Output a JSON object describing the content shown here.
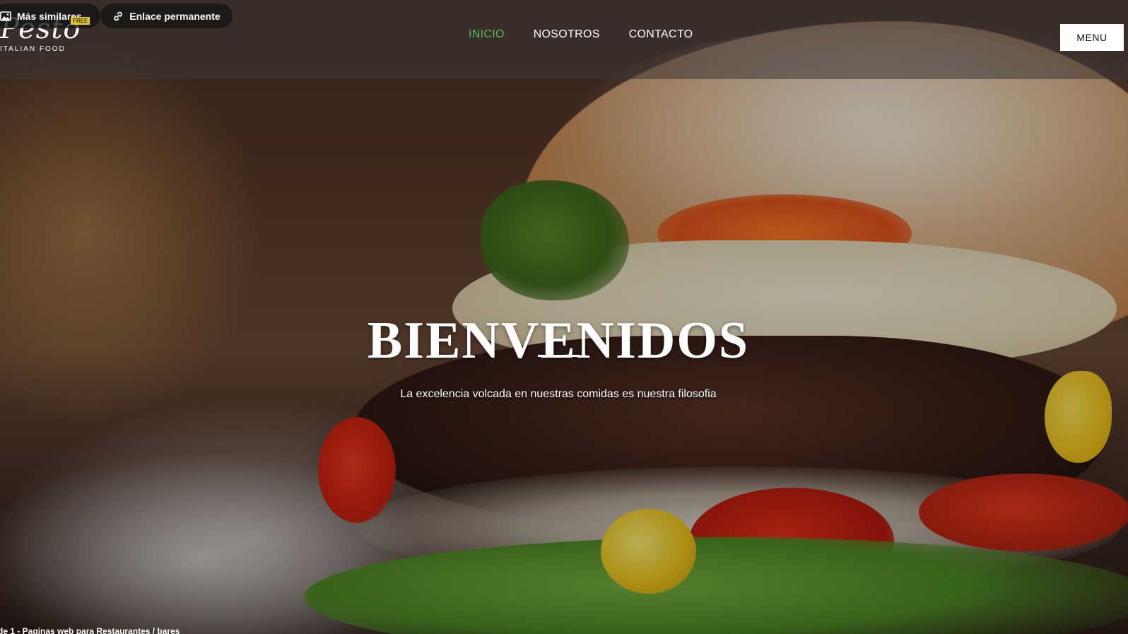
{
  "extension": {
    "similar_label": "Más similares",
    "free_badge": "FREE",
    "permalink_label": "Enlace permanente"
  },
  "brand": {
    "logo_script": "Pesto",
    "logo_sub": "ITALIAN FOOD"
  },
  "nav": {
    "items": [
      {
        "label": "INICIO",
        "active": true
      },
      {
        "label": "NOSOTROS",
        "active": false
      },
      {
        "label": "CONTACTO",
        "active": false
      }
    ],
    "menu_label": "MENU",
    "active_color": "#5cb85c"
  },
  "hero": {
    "title": "BIENVENIDOS",
    "subtitle": "La excelencia volcada en nuestras comidas es nuestra filosofia"
  },
  "footer": {
    "caption": "de 1 - Paginas web para Restaurantes / bares"
  }
}
